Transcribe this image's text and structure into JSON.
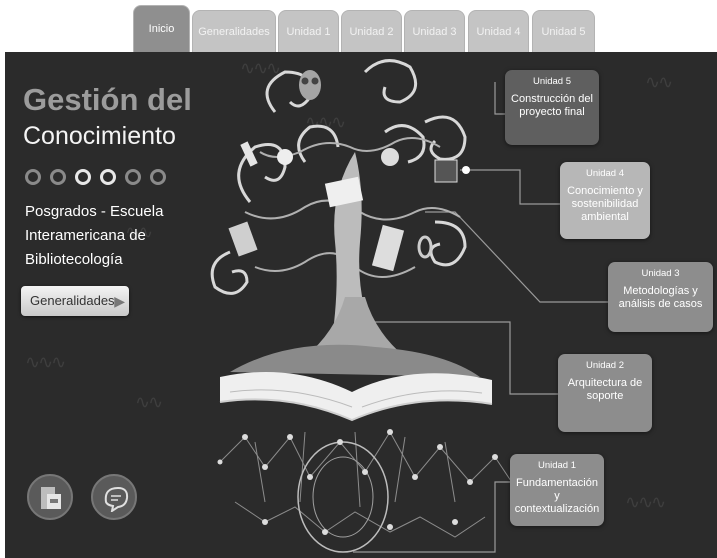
{
  "tabs": [
    {
      "label": "Inicio",
      "active": true
    },
    {
      "label": "Generalidades"
    },
    {
      "label": "Unidad 1"
    },
    {
      "label": "Unidad 2"
    },
    {
      "label": "Unidad 3"
    },
    {
      "label": "Unidad 4"
    },
    {
      "label": "Unidad 5"
    }
  ],
  "header": {
    "title_line1": "Gestión del",
    "title_line2": "Conocimiento",
    "subtitle": "Posgrados - Escuela Interamericana de Bibliotecología"
  },
  "nav": {
    "dots": 6,
    "generalidades_label": "Generalidades"
  },
  "icons": {
    "left": "library-book-icon",
    "right": "chat-head-icon"
  },
  "units": [
    {
      "title": "Unidad 5",
      "desc": "Construcción del proyecto final"
    },
    {
      "title": "Unidad 4",
      "desc": "Conocimiento y sostenibilidad ambiental"
    },
    {
      "title": "Unidad 3",
      "desc": "Metodologías y análisis de casos"
    },
    {
      "title": "Unidad 2",
      "desc": "Arquitectura de soporte"
    },
    {
      "title": "Unidad 1",
      "desc": "Fundamentación y contextualización"
    }
  ],
  "colors": {
    "stage_bg": "#2b2b2b",
    "tab_bg": "#c4c4c4",
    "tab_active": "#8f8f8f",
    "unit5": "#5f5f5f",
    "unit4": "#b7b7b7",
    "unit3": "#8d8d8d",
    "unit2": "#8d8d8d",
    "unit1": "#8d8d8d"
  }
}
